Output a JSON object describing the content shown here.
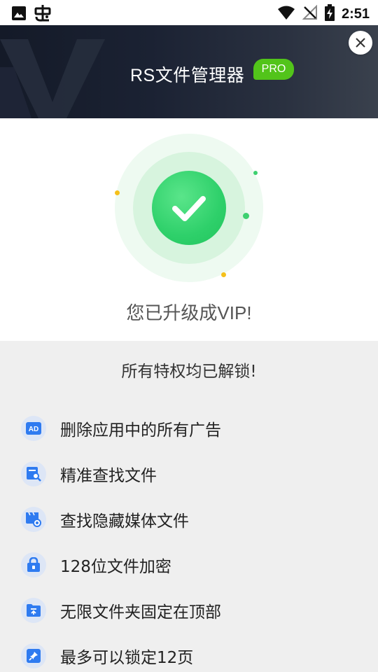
{
  "status_bar": {
    "time": "2:51",
    "left_icons": [
      "image-icon",
      "bug-icon"
    ],
    "right_icons": [
      "wifi-icon",
      "no-signal-icon",
      "battery-charging-icon"
    ]
  },
  "header": {
    "title": "RS文件管理器",
    "badge": "PRO",
    "badge_color": "#52c41a",
    "close_icon": "close-icon"
  },
  "success": {
    "message": "您已升级成VIP!",
    "icon": "checkmark-icon",
    "accent_color": "#2ed06a"
  },
  "privileges": {
    "heading": "所有特权均已解锁!",
    "items": [
      {
        "label": "删除应用中的所有广告",
        "icon": "ad-block-icon"
      },
      {
        "label": "精准查找文件",
        "icon": "file-search-icon"
      },
      {
        "label": "查找隐藏媒体文件",
        "icon": "hidden-media-icon"
      },
      {
        "label": "128位文件加密",
        "icon": "lock-icon"
      },
      {
        "label": "无限文件夹固定在顶部",
        "icon": "folder-pin-icon"
      },
      {
        "label": "最多可以锁定12页",
        "icon": "pin-icon"
      }
    ]
  }
}
